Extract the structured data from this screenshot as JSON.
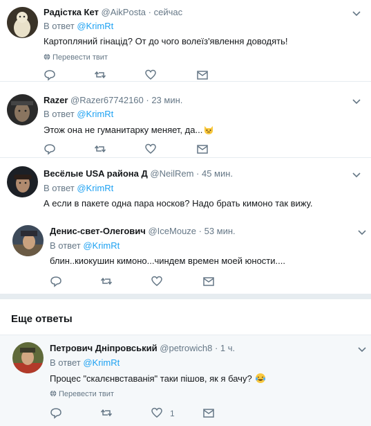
{
  "reply_prefix": "В ответ",
  "translate_label": "Перевести твит",
  "more_replies_title": "Еще ответы",
  "accent_color": "#1da1f2",
  "tweets": [
    {
      "name": "Радістка Кет",
      "handle": "@AikPosta",
      "time": "· сейчас",
      "reply_to": "@KrimRt",
      "text": "Картопляний гінацід? От до чого волеїз'явлення доводять!",
      "has_translate": true,
      "likes": ""
    },
    {
      "name": "Razer",
      "handle": "@Razer67742160",
      "time": "· 23 мин.",
      "reply_to": "@KrimRt",
      "text": "Этож она не гуманитарку меняет, да...",
      "emoji": "cat-face-emoji",
      "has_translate": false,
      "likes": ""
    },
    {
      "name": "Весёлые USA района Д",
      "handle": "@NeilRem",
      "time": "· 45 мин.",
      "reply_to": "@KrimRt",
      "text": "А если в пакете одна пара носков? Надо брать кимоно так вижу.",
      "has_translate": false,
      "likes": ""
    },
    {
      "name": "Денис-свет-Олегович",
      "handle": "@IceMouze",
      "time": "· 53 мин.",
      "reply_to": "@KrimRt",
      "text": "блин..киокушин кимоно...чиндем времен моей юности....",
      "has_translate": false,
      "likes": ""
    },
    {
      "name": "Петрович Дніпровський",
      "handle": "@petrowich8",
      "time": "· 1 ч.",
      "reply_to": "@KrimRt",
      "text": "Процес \"скалєнвставанія\" таки пішов, як я бачу?",
      "emoji": "crying-laughing-emoji",
      "has_translate": true,
      "likes": "1"
    }
  ]
}
